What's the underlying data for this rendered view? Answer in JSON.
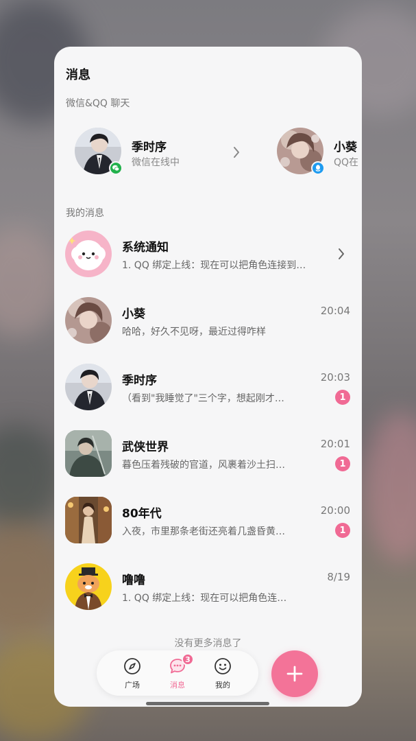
{
  "header": {
    "title": "消息"
  },
  "linked_section": {
    "label": "微信&QQ 聊天",
    "items": [
      {
        "name": "季时序",
        "status": "微信在线中",
        "badge_icon": "wechat-icon",
        "badge_color": "#22b14c"
      },
      {
        "name": "小葵",
        "status": "QQ在",
        "badge_icon": "qq-icon",
        "badge_color": "#1e9bf0"
      }
    ]
  },
  "messages_section": {
    "label": "我的消息",
    "items": [
      {
        "name": "系统通知",
        "preview": "1. QQ 绑定上线：现在可以把角色连接到…",
        "time": "",
        "unread": ""
      },
      {
        "name": "小葵",
        "preview": "哈哈，好久不见呀，最近过得咋样",
        "time": "20:04",
        "unread": ""
      },
      {
        "name": "季时序",
        "preview": "（看到\"我睡觉了\"三个字，想起刚才…",
        "time": "20:03",
        "unread": "1"
      },
      {
        "name": "武侠世界",
        "preview": "暮色压着残破的官道，风裹着沙土扫…",
        "time": "20:01",
        "unread": "1"
      },
      {
        "name": "80年代",
        "preview": "入夜，市里那条老街还亮着几盏昏黄…",
        "time": "20:00",
        "unread": "1"
      },
      {
        "name": "噜噜",
        "preview": "1. QQ 绑定上线：现在可以把角色连…",
        "time": "8/19",
        "unread": ""
      }
    ]
  },
  "footer": {
    "no_more": "没有更多消息了"
  },
  "tabbar": {
    "tabs": [
      {
        "label": "广场",
        "icon": "compass-icon"
      },
      {
        "label": "消息",
        "icon": "chat-bubble-icon",
        "badge": "3"
      },
      {
        "label": "我的",
        "icon": "smiley-icon"
      }
    ],
    "fab_icon": "plus-icon"
  },
  "colors": {
    "accent": "#f06a94",
    "background": "#f6f6f7"
  }
}
